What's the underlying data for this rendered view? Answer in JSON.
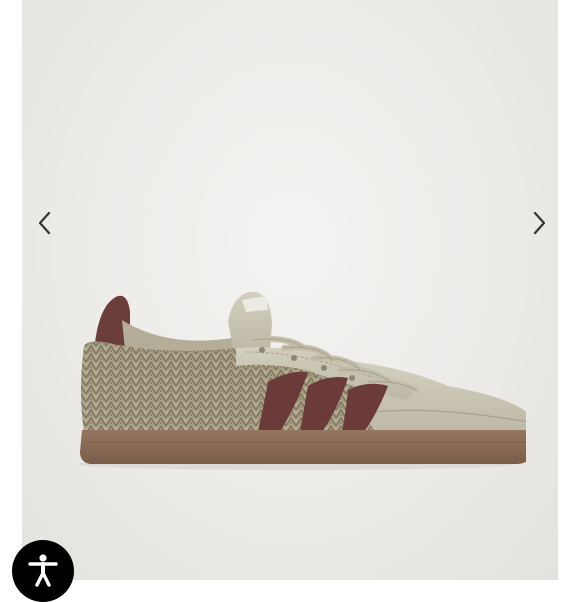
{
  "gallery": {
    "background_color": "#efefed",
    "prev_icon": "chevron-left-icon",
    "next_icon": "chevron-right-icon"
  },
  "product_image": {
    "colors": {
      "suede": "#c9c5b3",
      "tweed": "#a39a80",
      "stripes": "#6b3b3a",
      "gum_sole": "#8b6b52"
    }
  },
  "accessibility": {
    "icon": "accessibility-person-icon",
    "color": "#000000"
  }
}
